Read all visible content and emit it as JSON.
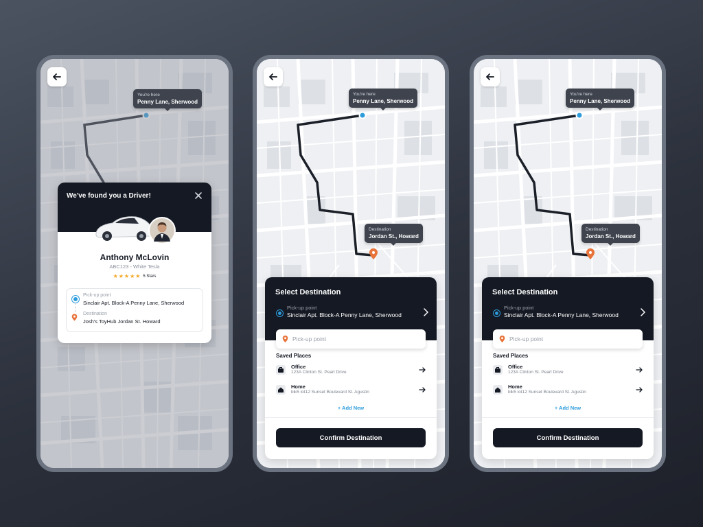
{
  "icons": {
    "back": "arrow-left-icon",
    "close": "close-icon",
    "chevron": "chevron-right-icon",
    "pin": "location-pin-icon",
    "briefcase": "briefcase-icon",
    "home": "home-icon",
    "arrow": "arrow-right-icon",
    "star": "star-icon"
  },
  "colors": {
    "dark": "#151923",
    "blue": "#2d9cdb",
    "orange": "#e8743b",
    "star": "#f5a623",
    "accent_link": "#2d9cdb"
  },
  "map": {
    "start_label": "You're here",
    "start_place": "Penny Lane, Sherwood",
    "dest_label": "Destination",
    "dest_place": "Jordan St., Howard"
  },
  "driver_card": {
    "title": "We've found you a Driver!",
    "driver_name": "Anthony McLovin",
    "car": "ABC123 - White Tesla",
    "rating": 5,
    "rating_text": "5 Stars",
    "pickup_label": "Pick-up point",
    "pickup_value": "Sinclair Apt. Block-A Penny Lane, Sherwood",
    "dest_label": "Destination",
    "dest_value": "Josh's ToyHub Jordan St. Howard"
  },
  "select": {
    "title": "Select Destination",
    "pickup_label": "Pick-up point",
    "pickup_value": "Sinclair Apt. Block-A Penny Lane, Sherwood",
    "input_placeholder": "Pick-up point",
    "saved_title": "Saved Places",
    "places": [
      {
        "name": "Office",
        "address": "123A Clinton St. Pearl Drive"
      },
      {
        "name": "Home",
        "address": "blk5 lot12 Sunset Boulevard St. Agustin"
      }
    ],
    "add_new": "+ Add New",
    "confirm": "Confirm Destination"
  }
}
